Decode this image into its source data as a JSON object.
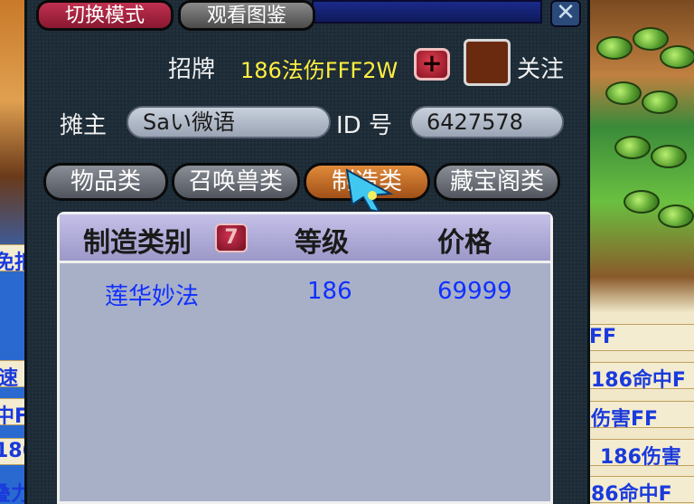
{
  "header": {
    "mode_button": "切换模式",
    "atlas_button": "观看图鉴",
    "close_icon": "close-icon"
  },
  "stall": {
    "sign_label": "招牌",
    "sign_value": "186法伤FFF2W",
    "plus_label": "+",
    "follow_label": "关注",
    "owner_label": "摊主",
    "owner_value": "Saい微语",
    "id_label": "ID 号",
    "id_value": "6427578"
  },
  "categories": [
    {
      "label": "物品类",
      "active": false
    },
    {
      "label": "召唤兽类",
      "active": false
    },
    {
      "label": "制造类",
      "active": true
    },
    {
      "label": "藏宝阁类",
      "active": false
    }
  ],
  "table": {
    "columns": [
      "制造类别",
      "等级",
      "价格"
    ],
    "sort_icon_label": "7",
    "rows": [
      {
        "category": "莲华妙法",
        "level": "186",
        "price": "69999"
      }
    ]
  },
  "background": {
    "left_texts": [
      "免扣",
      "速",
      "中F",
      "186",
      "叠力"
    ],
    "right_texts": [
      "FF",
      "186命中F",
      "伤害FF",
      "186伤害",
      "86命中F"
    ]
  }
}
